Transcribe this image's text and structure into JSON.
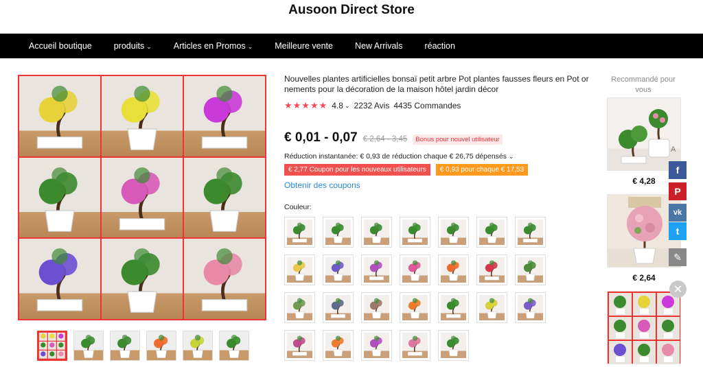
{
  "store": {
    "title": "Ausoon Direct Store"
  },
  "nav": {
    "items": [
      {
        "label": "Accueil boutique",
        "dropdown": false
      },
      {
        "label": "produits",
        "dropdown": true
      },
      {
        "label": "Articles en Promos",
        "dropdown": true
      },
      {
        "label": "Meilleure vente",
        "dropdown": false
      },
      {
        "label": "New Arrivals",
        "dropdown": false
      },
      {
        "label": "réaction",
        "dropdown": false
      }
    ]
  },
  "product": {
    "title": "Nouvelles plantes artificielles bonsaï petit arbre Pot plantes fausses fleurs en Pot or nements pour la décoration de la maison hôtel jardin décor",
    "rating": "4.8",
    "stars": "★★★★★",
    "reviews": "2232 Avis",
    "orders": "4435 Commandes",
    "price": "€ 0,01 - 0,07",
    "old_price": "€ 2,64 - 3,45",
    "bonus_label": "Bonus pour nouvel utilisateur",
    "reduction": "Réduction instantanée: € 0,93 de réduction chaque € 26,75 dépensés",
    "coupon_new_user": "€ 2,77 Coupon pour les nouveaux utilisateurs",
    "coupon_each": "€ 0,93 pour chaque € 17,53",
    "obtain_coupons": "Obtenir des coupons",
    "color_label": "Couleur:"
  },
  "swatch_colors": [
    "#3b8a2e",
    "#3b8a2e",
    "#3b8a2e",
    "#3b8a2e",
    "#3b8a2e",
    "#3b8a2e",
    "#3b8a2e",
    "#e8c94a",
    "#6c5cc7",
    "#b04fc0",
    "#e0579a",
    "#ef6b2e",
    "#d8344a",
    "#4f8a3a",
    "#6f9a52",
    "#5f6b8a",
    "#9b7a6a",
    "#ef7b2e",
    "#3b8a2e",
    "#d6d23a",
    "#7a5cc7",
    "#c04a8a",
    "#ef7b2e",
    "#b04fc0",
    "#e077a0",
    "#3b8a2e"
  ],
  "gallery_colors": [
    "#e8d23a",
    "#e8e03a",
    "#c93ad8",
    "#3b8a2e",
    "#d85ab8",
    "#3b8a2e",
    "#6a4fd0",
    "#3b8a2e",
    "#e88aa8"
  ],
  "recommended": {
    "title": "Recommandé pour vous",
    "items": [
      {
        "price": "€ 4,28"
      },
      {
        "price": "€ 2,64"
      }
    ]
  },
  "social": [
    {
      "icon": "facebook-icon",
      "glyph": "f",
      "color": "#3b5998"
    },
    {
      "icon": "pinterest-icon",
      "glyph": "P",
      "color": "#cb2027"
    },
    {
      "icon": "vk-icon",
      "glyph": "vk",
      "color": "#4a76a8"
    },
    {
      "icon": "twitter-icon",
      "glyph": "t",
      "color": "#1da1f2"
    },
    {
      "icon": "edit-icon",
      "glyph": "✎",
      "color": "#888888"
    }
  ],
  "close_glyph": "✕"
}
